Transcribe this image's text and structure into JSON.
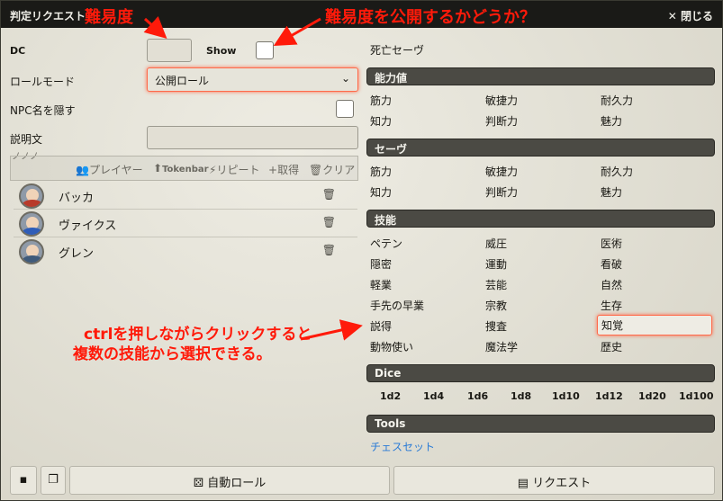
{
  "window": {
    "title": "判定リクエスト",
    "close_label": "閉じる"
  },
  "form": {
    "dc_label": "DC",
    "show_label": "Show",
    "roll_mode_label": "ロールモード",
    "roll_mode_value": "公開ロール",
    "hide_npc_label": "NPC名を隠す",
    "description_label": "説明文",
    "tokens_label_partial": "ノノノ"
  },
  "toolbar": {
    "players": "プレイヤー",
    "tokenbar": "Tokenbar",
    "repeat": "リピート",
    "get": "取得",
    "clear": "クリア"
  },
  "tokens": [
    {
      "name": "バッカ",
      "color": "#b83a2a"
    },
    {
      "name": "ヴァイクス",
      "color": "#2f5db8"
    },
    {
      "name": "グレン",
      "color": "#3f5a7a"
    }
  ],
  "right": {
    "death_save": "死亡セーヴ",
    "abilities_header": "能力値",
    "abilities": [
      "筋力",
      "敏捷力",
      "耐久力",
      "知力",
      "判断力",
      "魅力"
    ],
    "saves_header": "セーヴ",
    "saves": [
      "筋力",
      "敏捷力",
      "耐久力",
      "知力",
      "判断力",
      "魅力"
    ],
    "skills_header": "技能",
    "skills": [
      "ペテン",
      "威圧",
      "医術",
      "隠密",
      "運動",
      "看破",
      "軽業",
      "芸能",
      "自然",
      "手先の早業",
      "宗教",
      "生存",
      "説得",
      "捜査",
      "知覚",
      "動物使い",
      "魔法学",
      "歴史"
    ],
    "dice_header": "Dice",
    "dice": [
      "1d2",
      "1d4",
      "1d6",
      "1d8",
      "1d10",
      "1d12",
      "1d20",
      "1d100"
    ],
    "tools_header": "Tools",
    "tools_link": "チェスセット"
  },
  "buttons": {
    "auto_roll": "自動ロール",
    "request": "リクエスト"
  },
  "annotations": {
    "difficulty": "難易度",
    "show_difficulty": "難易度を公開するかどうか？",
    "ctrl_line1": "ctrlを押しながらクリックすると",
    "ctrl_line2": "複数の技能から選択できる。"
  },
  "colors": {
    "accent": "#ff6a4a",
    "annotation": "#ff1a0a",
    "header_bg": "#4b4a44",
    "link": "#2a7bd6"
  }
}
